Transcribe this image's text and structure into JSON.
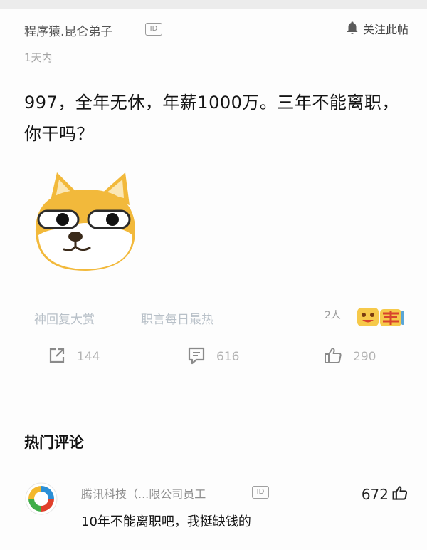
{
  "post": {
    "author": "程序猿.昆仑弟子",
    "id_badge": "ID",
    "follow_label": "关注此帖",
    "time": "1天内",
    "body": "997，全年无休，年薪1000万。三年不能离职，你干吗？",
    "emoji_icon": "doge-emoji"
  },
  "tags": {
    "items": [
      "神回复大赏",
      "职言每日最热"
    ],
    "reaction_count": "2人",
    "reaction_icon": "happy-reaction-emoji"
  },
  "actions": {
    "share_count": "144",
    "comment_count": "616",
    "like_count": "290"
  },
  "comments": {
    "section_title": "热门评论",
    "items": [
      {
        "author": "腾讯科技（...限公司员工",
        "id_badge": "ID",
        "likes": "672",
        "text": "10年不能离职吧，我挺缺钱的"
      }
    ]
  },
  "colors": {
    "tag_text": "#b8c0c8",
    "muted_text": "#a3a3a3",
    "doge_orange": "#f2b93b"
  }
}
